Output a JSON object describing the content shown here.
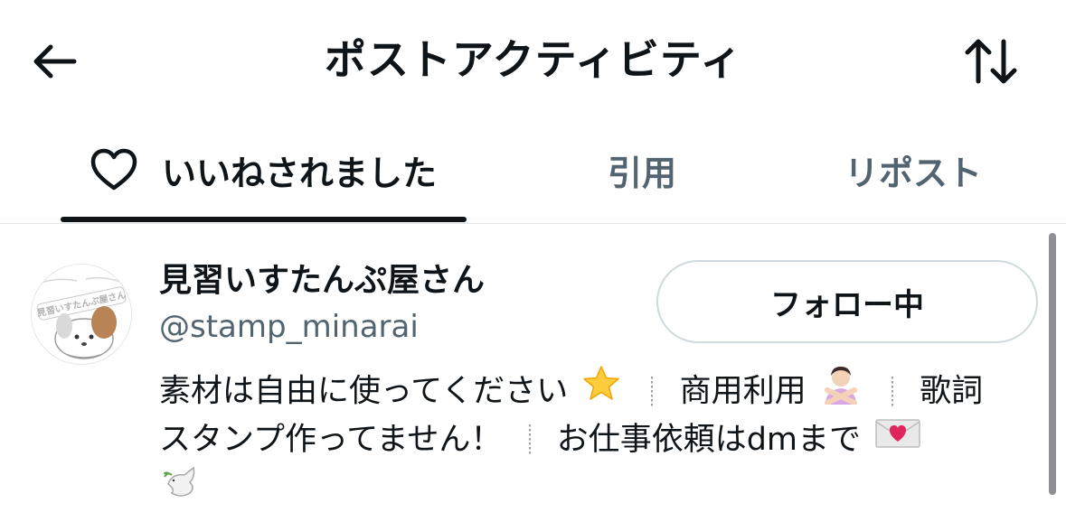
{
  "header": {
    "title": "ポストアクティビティ",
    "back_icon": "arrow-left-icon",
    "sort_icon": "sort-arrows-icon"
  },
  "tabs": [
    {
      "label": "いいねされました",
      "icon": "heart-outline-icon",
      "active": true
    },
    {
      "label": "引用",
      "active": false
    },
    {
      "label": "リポスト",
      "active": false
    }
  ],
  "user": {
    "display_name": "見習いすたんぷ屋さん",
    "handle": "@stamp_minarai",
    "avatar_text": "見習いすたんぷ屋さん",
    "follow_label": "フォロー中",
    "bio": {
      "line1_a": "素材は自由に使ってください",
      "line1_b": "商用利用",
      "line1_c": "歌詞",
      "line2_a": "スタンプ作ってません！",
      "line2_b": "お仕事依頼はdmまで"
    }
  },
  "colors": {
    "text_primary": "#0f1419",
    "text_secondary": "#536471",
    "border": "#cfd9de"
  }
}
